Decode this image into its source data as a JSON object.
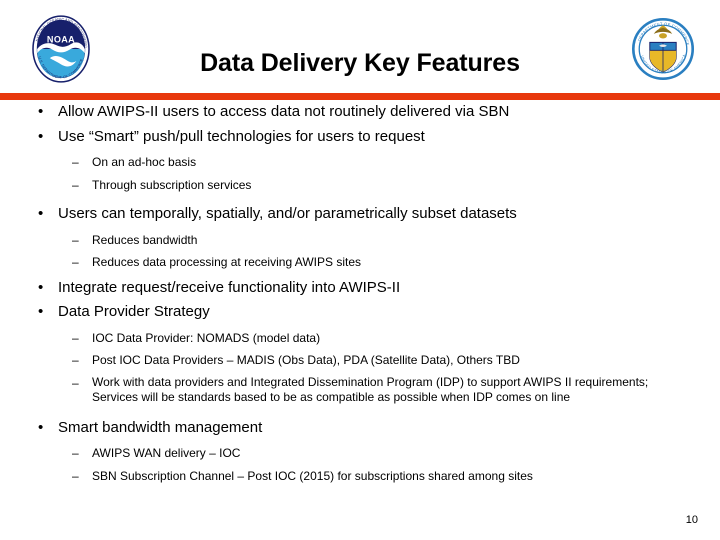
{
  "header": {
    "title": "Data Delivery Key Features",
    "left_logo": "noaa-seal-logo",
    "right_logo": "department-of-commerce-seal-logo",
    "divider_color": "#E8380D"
  },
  "markers": {
    "level1": "•",
    "level2": "–"
  },
  "body": {
    "bullets": [
      {
        "level": 1,
        "text": "Allow AWIPS-II users to access data not routinely delivered via SBN"
      },
      {
        "level": 1,
        "text": "Use “Smart” push/pull technologies for users to request"
      },
      {
        "level": 2,
        "text": "On an ad-hoc basis"
      },
      {
        "level": 2,
        "text": "Through subscription services"
      },
      {
        "level": 1,
        "text": "Users can temporally, spatially, and/or parametrically subset datasets"
      },
      {
        "level": 2,
        "text": "Reduces bandwidth"
      },
      {
        "level": 2,
        "text": "Reduces data processing at receiving AWIPS sites"
      },
      {
        "level": 1,
        "text": "Integrate request/receive functionality into AWIPS-II"
      },
      {
        "level": 1,
        "text": "Data Provider Strategy"
      },
      {
        "level": 2,
        "text": "IOC Data Provider: NOMADS (model data)"
      },
      {
        "level": 2,
        "text": "Post IOC Data Providers – MADIS (Obs Data), PDA (Satellite Data),  Others TBD"
      },
      {
        "level": 2,
        "text": "Work with data providers and Integrated Dissemination Program (IDP) to support AWIPS II requirements; Services will be standards based to be as compatible as possible when IDP comes on line"
      },
      {
        "level": 1,
        "text": "Smart bandwidth management"
      },
      {
        "level": 2,
        "text": "AWIPS WAN delivery – IOC"
      },
      {
        "level": 2,
        "text": "SBN Subscription Channel – Post IOC (2015) for subscriptions shared among sites"
      }
    ]
  },
  "footer": {
    "page_number": "10"
  }
}
